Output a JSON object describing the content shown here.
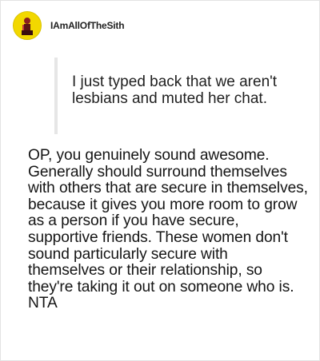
{
  "post": {
    "username": "IAmAllOfTheSith",
    "avatar_icon": "sith-character-avatar-icon",
    "avatar_color": "#f2d800",
    "quote_text": "I just typed back that we aren't lesbians and muted her chat.",
    "body_text": "OP, you genuinely sound awesome. Generally should surround themselves with others that are secure in themselves, because it gives you more room to grow as a person if you have secure, supportive friends. These women don't sound particularly secure with themselves or their relationship, so they're taking it out on someone who is. NTA"
  }
}
